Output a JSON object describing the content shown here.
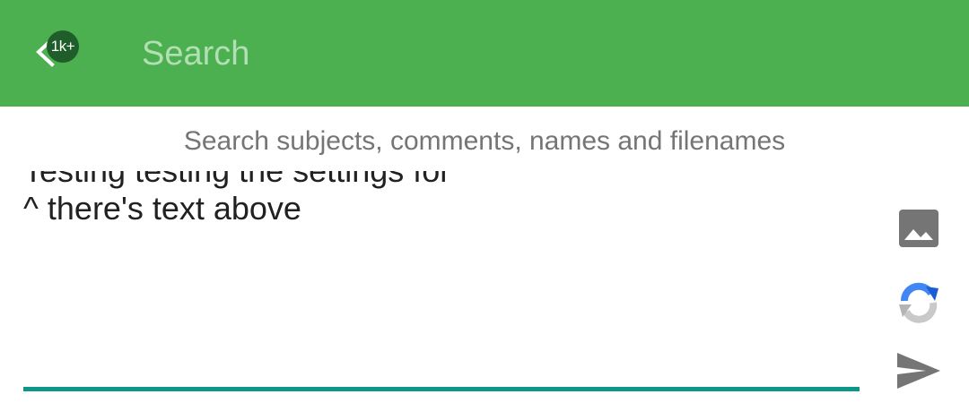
{
  "header": {
    "back_icon": "arrow-left-icon",
    "badge_count": "1k+",
    "search_placeholder": "Search"
  },
  "hint": {
    "text": "Search subjects, comments, names and filenames"
  },
  "composer": {
    "lines": [
      "Testing testing the settings for",
      "^ there's text above"
    ]
  },
  "actions": {
    "image_icon": "image-icon",
    "refresh_icon": "captcha-refresh-icon",
    "send_icon": "send-icon"
  },
  "colors": {
    "header_bg": "#4caf50",
    "badge_bg": "#1f5d2a",
    "accent_underline": "#0e968a",
    "hint_text": "#757575",
    "icon_gray": "#757575"
  }
}
